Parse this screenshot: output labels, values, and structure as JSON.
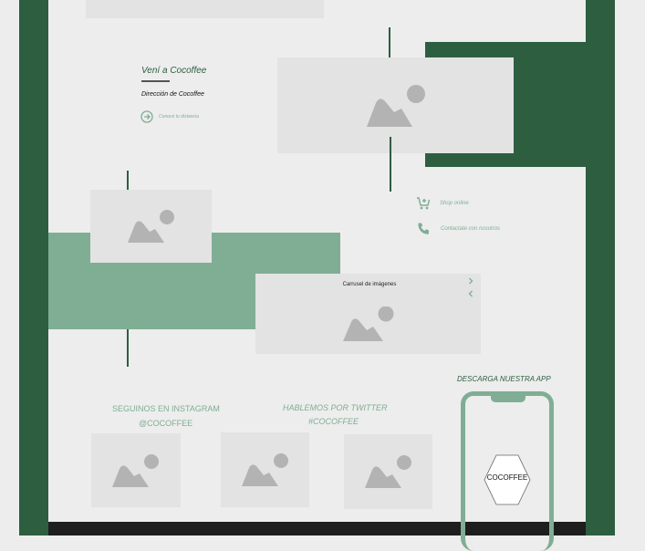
{
  "visit": {
    "title": "Vení a Cocoffee",
    "address": "Dirección de Cocoffee",
    "distance_link": "Conocé tu distancia"
  },
  "contact": {
    "shop_label": "Shop online",
    "contact_label": "Contactate con nosotros"
  },
  "carousel": {
    "title": "Carrusel de imágenes"
  },
  "social": {
    "instagram_title": "SEGUINOS EN INSTAGRAM",
    "instagram_handle": "@COCOFFEE",
    "twitter_title": "HABLEMOS POR TWITTER",
    "twitter_handle": "#COCOFFEE"
  },
  "app": {
    "download_title": "DESCARGA NUESTRA APP",
    "logo_text": "COCOFFEE"
  },
  "colors": {
    "dark_green": "#2d5e40",
    "light_green": "#7fae94",
    "placeholder": "#e3e3e3",
    "footer": "#1e1e1e"
  },
  "icons": [
    "image-placeholder-icon",
    "arrow-circle-right-icon",
    "cart-plus-icon",
    "phone-icon",
    "chevron-right-icon",
    "chevron-left-icon"
  ]
}
